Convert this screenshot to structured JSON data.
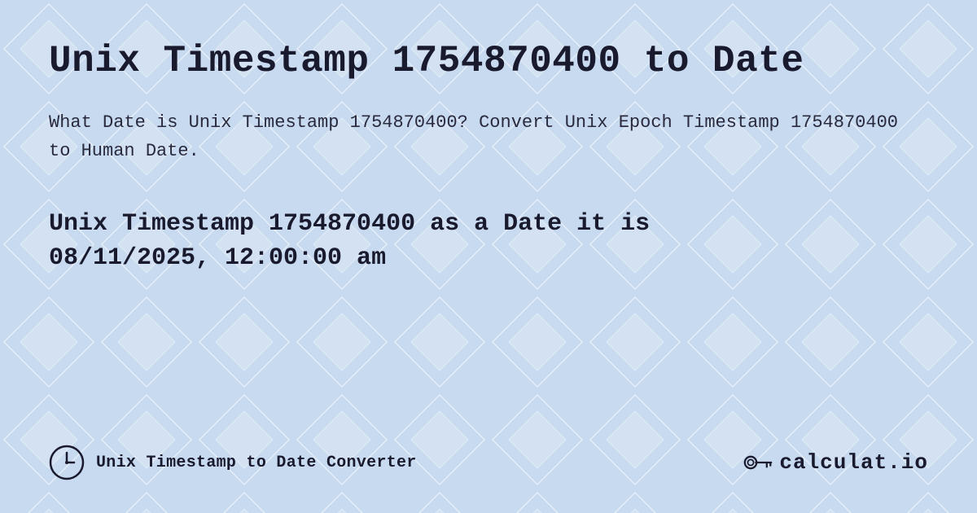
{
  "page": {
    "title": "Unix Timestamp 1754870400 to Date",
    "description": "What Date is Unix Timestamp 1754870400? Convert Unix Epoch Timestamp 1754870400 to Human Date.",
    "result_line1": "Unix Timestamp 1754870400 as a Date it is",
    "result_line2": "08/11/2025, 12:00:00 am",
    "footer_label": "Unix Timestamp to Date Converter",
    "logo_text": "calculat.io",
    "bg_color": "#c8daf0",
    "accent_color": "#1a1a2e"
  }
}
